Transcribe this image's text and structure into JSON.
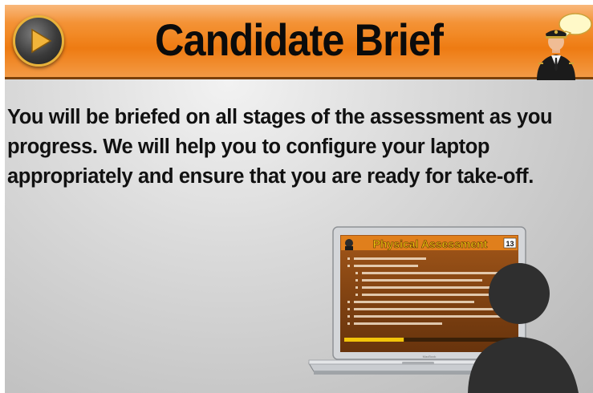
{
  "header": {
    "title": "Candidate Brief",
    "icons": [
      "play-icon",
      "pilot-speech-icon"
    ]
  },
  "body": {
    "text": "You will be briefed on all stages of the assessment as you progress. We will help you to configure your laptop appropriately  and ensure that you are ready for take-off."
  },
  "laptop_screen": {
    "title": "Physical Assessment",
    "slide_number": "13",
    "progress": 0.35
  },
  "colors": {
    "header_orange": "#f28a27",
    "header_border": "#7a4008",
    "play_ring": "#e8b23a",
    "screen_bg": "#8a4a12",
    "screen_title": "#f2c40a"
  }
}
